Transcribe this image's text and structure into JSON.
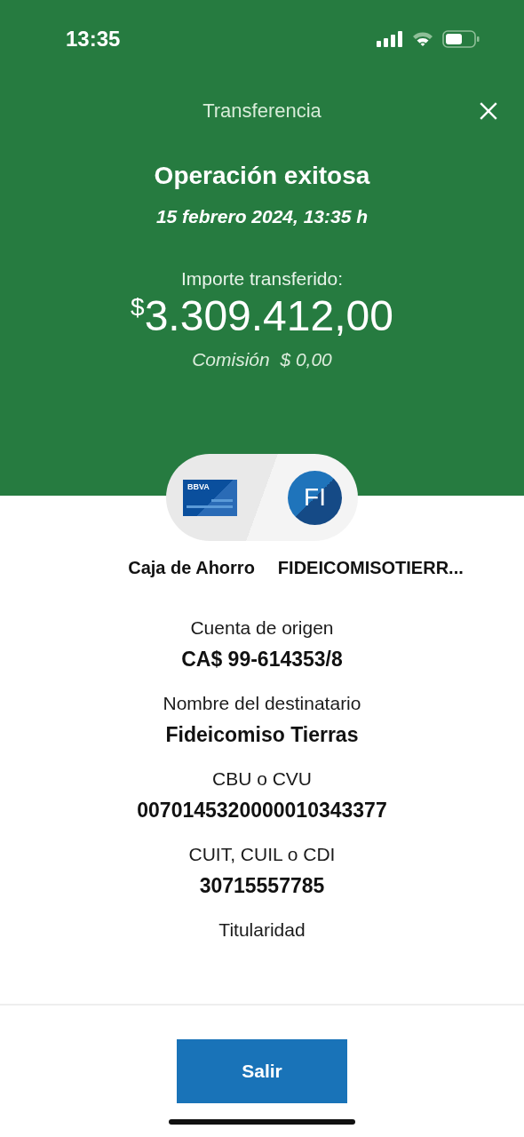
{
  "status_bar": {
    "time": "13:35"
  },
  "header": {
    "title": "Transferencia",
    "heading": "Operación exitosa",
    "date": "15 febrero 2024, 13:35 h",
    "amount_label": "Importe transferido:",
    "currency": "$",
    "amount": "3.309.412,00",
    "commission": "Comisión  $ 0,00"
  },
  "transfer": {
    "card_logo": "BBVA",
    "recipient_initials": "FI",
    "from": "Caja de Ahorro",
    "to": "FIDEICOMISOTIERR..."
  },
  "details": [
    {
      "label": "Cuenta de origen",
      "value": "CA$ 99-614353/8"
    },
    {
      "label": "Nombre del destinatario",
      "value": "Fideicomiso Tierras"
    },
    {
      "label": "CBU o CVU",
      "value": "0070145320000010343377"
    },
    {
      "label": "CUIT, CUIL o CDI",
      "value": "30715557785"
    },
    {
      "label": "Titularidad"
    }
  ],
  "buttons": [
    "Salir"
  ]
}
